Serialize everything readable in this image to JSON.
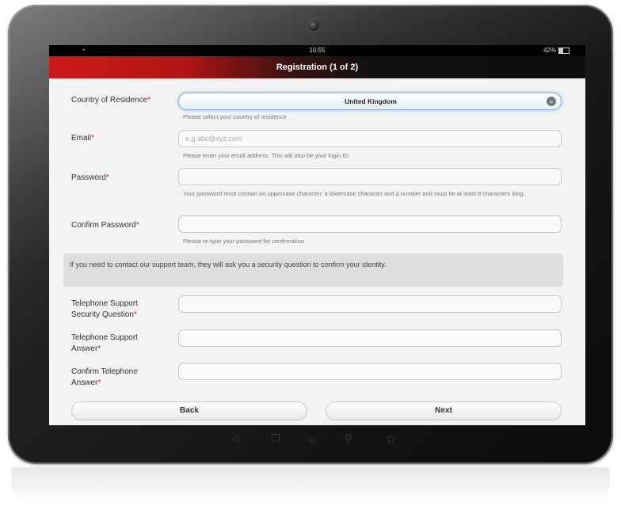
{
  "status": {
    "time": "10:55",
    "battery": "42%",
    "wifi_icon": "wifi-icon"
  },
  "header": {
    "title": "Registration (1 of 2)"
  },
  "form": {
    "country": {
      "label": "Country of Residence",
      "value": "United Kingdom",
      "hint": "Please select your country of residence"
    },
    "email": {
      "label": "Email",
      "placeholder": "e.g abc@xyz.com",
      "hint": "Please enter your email address. This will also be your login ID."
    },
    "password": {
      "label": "Password",
      "hint": "Your password must contain an uppercase character, a lowercase character and a number and must be at least 8 characters long."
    },
    "confirm_password": {
      "label": "Confirm Password",
      "hint": "Please re-type your password for confirmation"
    },
    "notice": "If you need to contact our support team, they will ask you a security question to confirm your identity.",
    "security_question": {
      "label_line1": "Telephone Support",
      "label_line2": "Security Question"
    },
    "support_answer": {
      "label_line1": "Telephone Support",
      "label_line2": "Answer"
    },
    "confirm_answer": {
      "label_line1": "Confirm Telephone",
      "label_line2": "Answer"
    },
    "required_mark": "*"
  },
  "buttons": {
    "back": "Back",
    "next": "Next"
  },
  "colors": {
    "accent": "#cc1a1a",
    "select_border": "#8fb3d9"
  }
}
